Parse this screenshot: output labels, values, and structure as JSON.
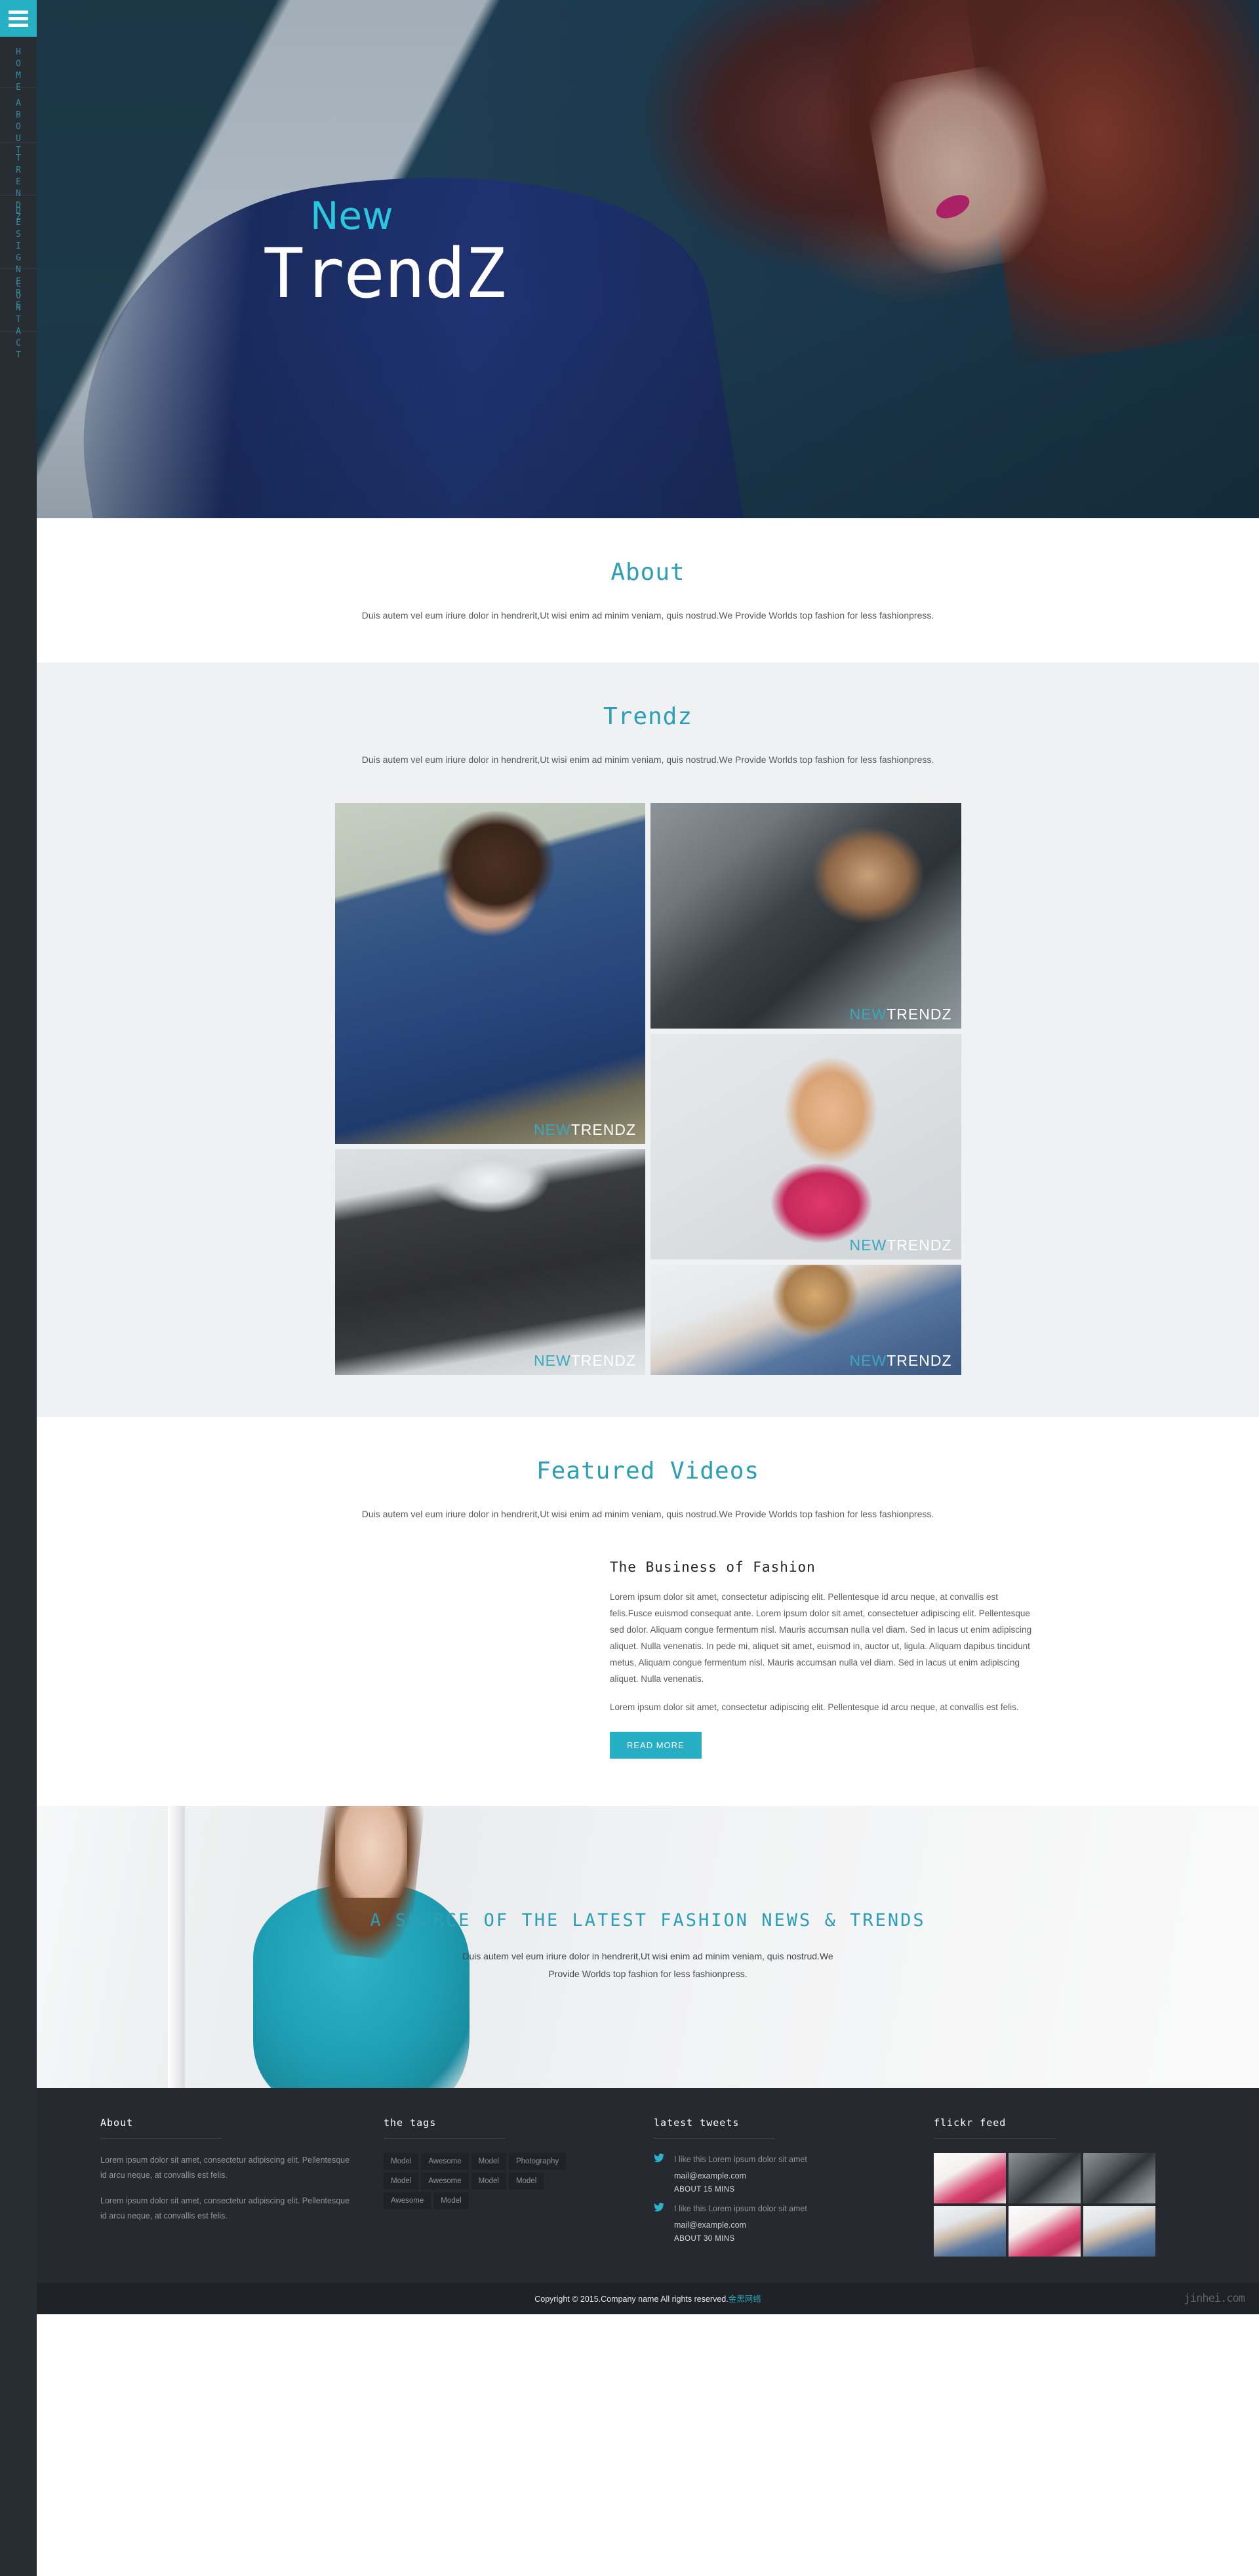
{
  "sidebar": {
    "menu_icon": "hamburger-icon",
    "items": [
      {
        "label": "HOME"
      },
      {
        "label": "ABOUT"
      },
      {
        "label": "TRENDZ"
      },
      {
        "label": "DESIGNERS"
      },
      {
        "label": "CONTACT"
      }
    ]
  },
  "hero": {
    "subtitle": "New",
    "title": "TrendZ"
  },
  "about": {
    "title": "About",
    "description": "Duis autem vel eum iriure dolor in hendrerit,Ut wisi enim ad minim veniam, quis nostrud.We Provide Worlds top fashion for less fashionpress."
  },
  "trendz": {
    "title": "Trendz",
    "description": "Duis autem vel eum iriure dolor in hendrerit,Ut wisi enim ad minim veniam, quis nostrud.We Provide Worlds top fashion for less fashionpress.",
    "gallery": [
      {
        "caption_first": "NEW",
        "caption_second": "TRENDZ",
        "alt": "man-in-blue-blazer"
      },
      {
        "caption_first": "NEW",
        "caption_second": "TRENDZ",
        "alt": "woman-in-leather-jacket-sunglasses"
      },
      {
        "caption_first": "NEW",
        "caption_second": "TRENDZ",
        "alt": "woman-in-pink-top"
      },
      {
        "caption_first": "NEW",
        "caption_second": "TRENDZ",
        "alt": "man-in-dark-jeans"
      },
      {
        "caption_first": "NEW",
        "caption_second": "TRENDZ",
        "alt": "man-in-denim-jacket-scarf"
      }
    ]
  },
  "videos": {
    "title": "Featured Videos",
    "description": "Duis autem vel eum iriure dolor in hendrerit,Ut wisi enim ad minim veniam, quis nostrud.We Provide Worlds top fashion for less fashionpress.",
    "article_title": "The Business of Fashion",
    "paragraph_1": "Lorem ipsum dolor sit amet, consectetur adipiscing elit. Pellentesque id arcu neque, at convallis est felis.Fusce euismod consequat ante. Lorem ipsum dolor sit amet, consectetuer adipiscing elit. Pellentesque sed dolor. Aliquam congue fermentum nisl. Mauris accumsan nulla vel diam. Sed in lacus ut enim adipiscing aliquet. Nulla venenatis. In pede mi, aliquet sit amet, euismod in, auctor ut, ligula. Aliquam dapibus tincidunt metus, Aliquam congue fermentum nisl. Mauris accumsan nulla vel diam. Sed in lacus ut enim adipiscing aliquet. Nulla venenatis.",
    "paragraph_2": "Lorem ipsum dolor sit amet, consectetur adipiscing elit. Pellentesque id arcu neque, at convallis est felis.",
    "read_more_label": "READ MORE"
  },
  "banner": {
    "title": "A SOURCE OF THE LATEST FASHION NEWS & TRENDS",
    "description": "Duis autem vel eum iriure dolor in hendrerit,Ut wisi enim ad minim veniam, quis nostrud.We Provide Worlds top fashion for less fashionpress."
  },
  "footer": {
    "about": {
      "title": "About",
      "paragraph_1": "Lorem ipsum dolor sit amet, consectetur adipiscing elit. Pellentesque id arcu neque, at convallis est felis.",
      "paragraph_2": "Lorem ipsum dolor sit amet, consectetur adipiscing elit. Pellentesque id arcu neque, at convallis est felis."
    },
    "tags": {
      "title": "the tags",
      "items": [
        "Model",
        "Awesome",
        "Model",
        "Photography",
        "Model",
        "Awesome",
        "Model",
        "Model",
        "Awesome",
        "Model"
      ]
    },
    "tweets": {
      "title": "latest tweets",
      "items": [
        {
          "icon": "twitter-bird-icon",
          "text": "I like this Lorem ipsum dolor sit amet",
          "mail": "mail@example.com",
          "time": "ABOUT 15 MINS"
        },
        {
          "icon": "twitter-bird-icon",
          "text": "I like this Lorem ipsum dolor sit amet",
          "mail": "mail@example.com",
          "time": "ABOUT 30 MINS"
        }
      ]
    },
    "flickr": {
      "title": "flickr feed",
      "items": [
        {
          "alt": "woman-in-pink-top"
        },
        {
          "alt": "woman-in-leather-jacket-sunglasses"
        },
        {
          "alt": "woman-in-leather-jacket-sunglasses"
        },
        {
          "alt": "man-in-denim-jacket-scarf"
        },
        {
          "alt": "woman-in-pink-top"
        },
        {
          "alt": "man-in-denim-jacket-scarf"
        }
      ]
    }
  },
  "copyright": {
    "text": "Copyright © 2015.Company name All rights reserved.",
    "link": "金黑网络",
    "watermark": "jinhei.com"
  },
  "colors": {
    "accent": "#26aec4",
    "accent_dark": "#2b9fb5",
    "hero_cyan": "#29c7e0",
    "footer_bg": "#26292f",
    "sidebar_bg": "#282c33",
    "copyright_bg": "#1e2126"
  }
}
